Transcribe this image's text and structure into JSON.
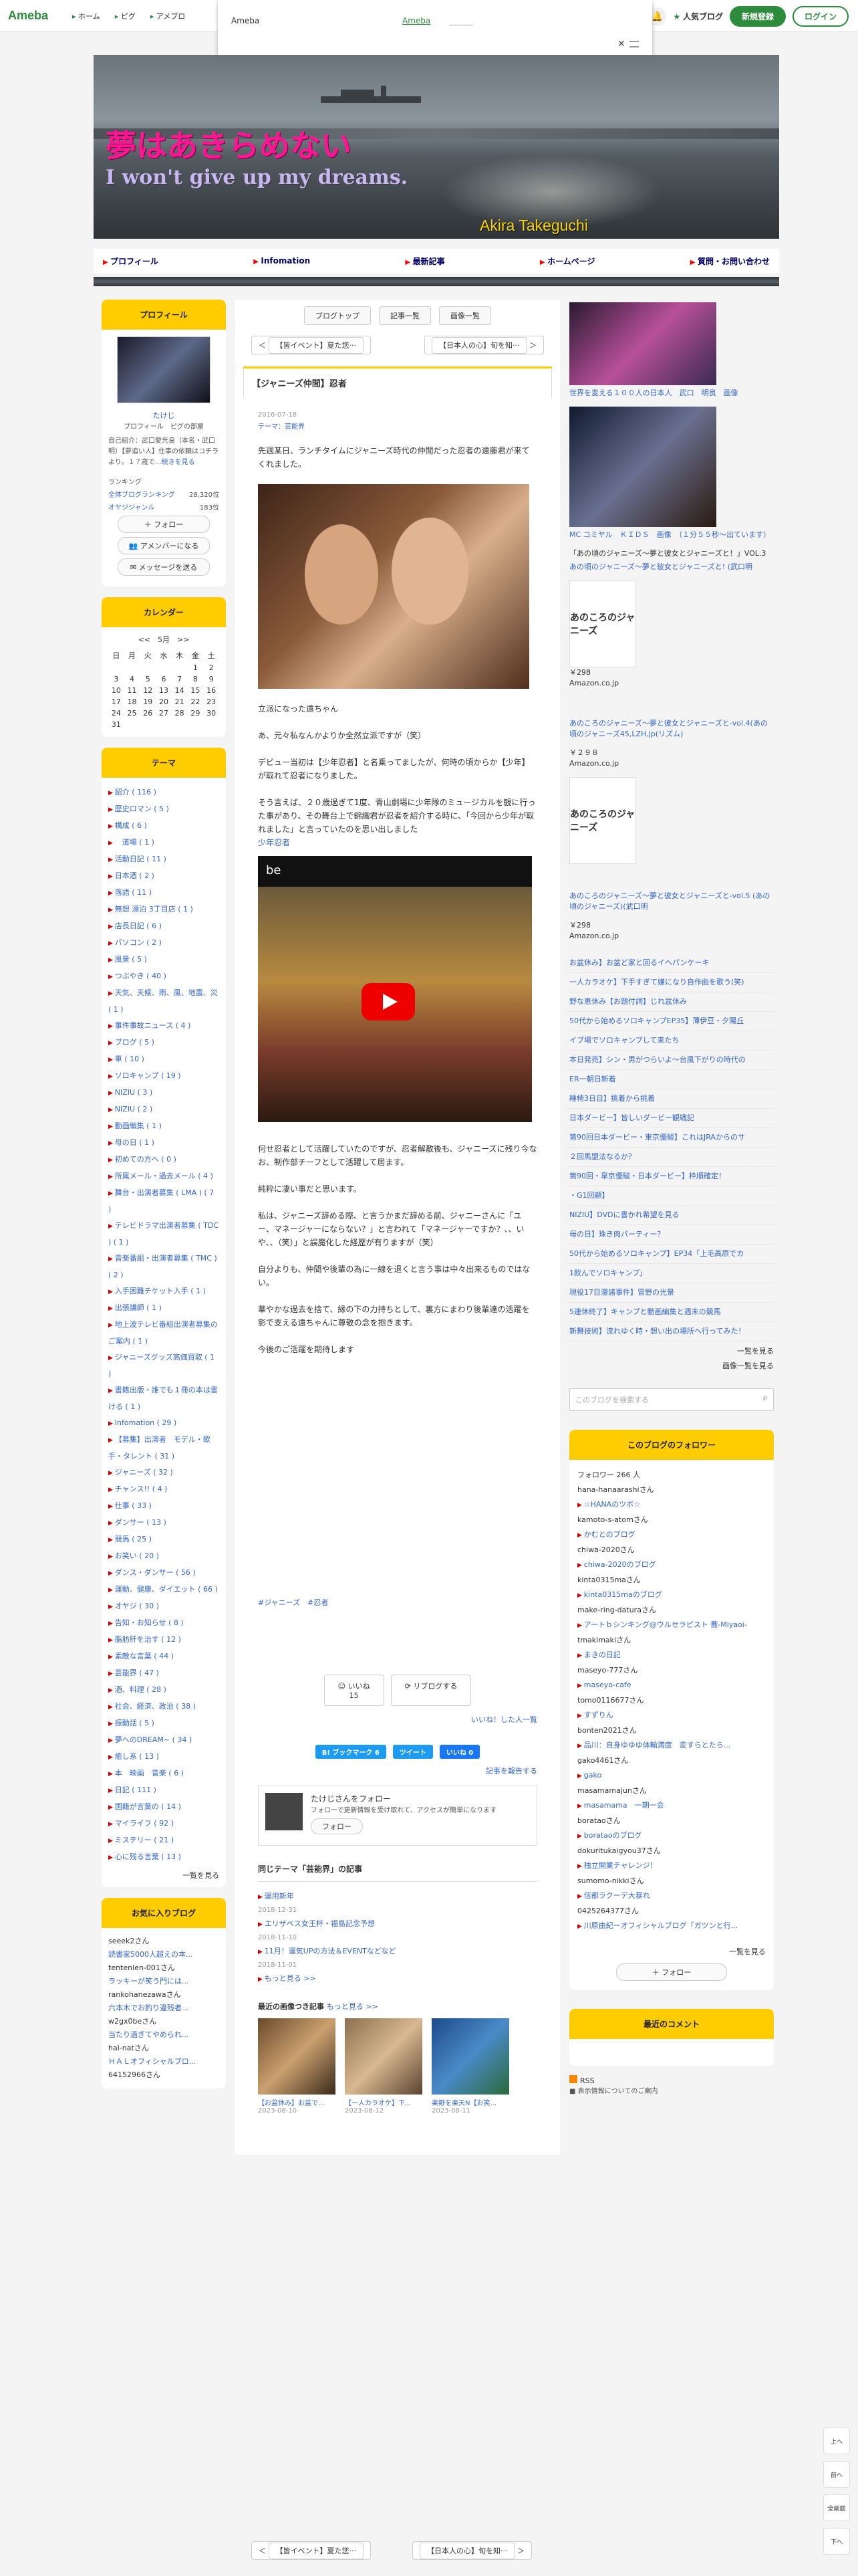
{
  "topbar": {
    "logo": "Ameba",
    "nav": [
      "ホーム",
      "ピグ",
      "アメブロ"
    ],
    "popup_title": "Ameba",
    "popup_link": "Ameba",
    "popular": "人気ブログ",
    "register": "新規登録",
    "login": "ログイン"
  },
  "header": {
    "title": "夢はあきらめない",
    "subtitle": "I won't give up my dreams.",
    "name": "Akira Takeguchi"
  },
  "gnav": [
    "プロフィール",
    "Infomation",
    "最新記事",
    "ホームページ",
    "質問・お問い合わせ"
  ],
  "profile": {
    "heading": "プロフィール",
    "name": "たけじ",
    "links": "プロフィール　ピグの部屋",
    "bio": "自己紹介：武口愛光良（本名・武口明）【夢追い人】仕事の依頼はコチラより。１７歳で",
    "bio_link": "…続きを見る",
    "ranking_label": "ランキング",
    "ranking_all": "全体ブログランキング",
    "ranking_all_val": "28,320位",
    "ranking_genre": "オヤジジャンル",
    "ranking_genre_val": "183位",
    "follow": "フォロー",
    "member": "アメンバーになる",
    "message": "メッセージを送る"
  },
  "calendar": {
    "heading": "カレンダー",
    "month": "5月",
    "days": [
      "日",
      "月",
      "火",
      "水",
      "木",
      "金",
      "土"
    ],
    "weeks": [
      [
        "",
        "",
        "",
        "",
        "",
        "1",
        "2"
      ],
      [
        "3",
        "4",
        "5",
        "6",
        "7",
        "8",
        "9"
      ],
      [
        "10",
        "11",
        "12",
        "13",
        "14",
        "15",
        "16"
      ],
      [
        "17",
        "18",
        "19",
        "20",
        "21",
        "22",
        "23"
      ],
      [
        "24",
        "25",
        "26",
        "27",
        "28",
        "29",
        "30"
      ],
      [
        "31",
        "",
        "",
        "",
        "",
        "",
        ""
      ]
    ]
  },
  "themes": {
    "heading": "テーマ",
    "items": [
      "紹介 ( 116 )",
      "歴史ロマン ( 5 )",
      "構成 ( 6 )",
      "　道場 ( 1 )",
      "活動日記 ( 11 )",
      "日本酒 ( 2 )",
      "落語 ( 11 )",
      "無想 漂泊 3丁目店 ( 1 )",
      "店長日記 ( 6 )",
      "パソコン ( 2 )",
      "風景 ( 5 )",
      "つぶやき ( 40 )",
      "天気、天候、雨、風、地震、災 ( 1 )",
      "事件事故ニュース ( 4 )",
      "ブログ ( 5 )",
      "車 ( 10 )",
      "ソロキャンプ ( 19 )",
      "NIZIU ( 3 )",
      "NIZIU ( 2 )",
      "動画編集 ( 1 )",
      "母の日 ( 1 )",
      "初めての方へ ( 0 )",
      "所属メール・過去メール ( 4 )",
      "舞台・出演者募集 ( LMA ) ( 7 )",
      "テレビドラマ出演者募集 ( TDC ) ( 1 )",
      "音楽番組・出演者募集 ( TMC ) ( 2 )",
      "入手困難チケット入手 ( 1 )",
      "出張講師 ( 1 )",
      "地上波テレビ番組出演者募集のご案内 ( 1 )",
      "ジャニーズグッズ高価買取 ( 1 )",
      "書籍出版・誰でも１冊の本は書ける ( 1 )",
      "Infomation ( 29 )",
      "【募集】出演者　モデル・歌手・タレント ( 31 )",
      "ジャニーズ ( 32 )",
      "チャンス!! ( 4 )",
      "仕事 ( 33 )",
      "ダンサー ( 13 )",
      "競馬 ( 25 )",
      "お笑い ( 20 )",
      "ダンス・ダンサー ( 56 )",
      "運動、健康、ダイエット ( 66 )",
      "オヤジ ( 30 )",
      "告知・お知らせ ( 8 )",
      "脂肪肝を治す ( 12 )",
      "素敵な言葉 ( 44 )",
      "芸能界 ( 47 )",
      "酒、料理 ( 28 )",
      "社会、経済、政治 ( 38 )",
      "振動話 ( 5 )",
      "夢へのDREAM~ ( 34 )",
      "癒し系 ( 13 )",
      "本　映画　音楽 ( 6 )",
      "日記 ( 111 )",
      "国籍が言葉の ( 14 )",
      "マイライフ ( 92 )",
      "ミステリー ( 21 )",
      "心に残る言葉 ( 13 )"
    ],
    "more": "一覧を見る"
  },
  "followed_blogs": {
    "heading": "お気に入りブログ",
    "items": [
      "seeek2さん",
      "読書家5000人超えの本...",
      "tentenlen-001さん",
      "ラッキーが笑う門には...",
      "rankohanezawaさん",
      "六本木でお釣り違残者...",
      "w2gx0beさん",
      "当たり過ぎてやめられ...",
      "hal-natさん",
      "ＨＡＬオフィシャルブロ...",
      "64152966さん"
    ]
  },
  "main": {
    "tabs": [
      "ブログトップ",
      "記事一覧",
      "画像一覧"
    ],
    "prev": "【皆イベント】夏た您···",
    "next": "【日本人の心】旬を知···",
    "title": "【ジャニーズ仲間】忍者",
    "date": "2016-07-18",
    "theme": "テーマ：芸能界",
    "p1": "先週某日、ランチタイムにジャニーズ時代の仲間だった忍者の遠藤君が来てくれました。",
    "p2": "立派になった遠ちゃん",
    "p3": "あ、元々私なんかよりか全然立派ですが（笑）",
    "p4": "デビュー当初は【少年忍者】と名乗ってましたが、何時の頃からか【少年】が取れて忍者になりました。",
    "p5": "そう言えば、２０歳過ぎて1度、青山劇場に少年隊のミュージカルを観に行った事があり、その舞台上で錦織君が忍者を紹介する時に、「今回から少年が取れました」と言っていたのを思い出しました",
    "p5_link": "少年忍者",
    "video_label": "be",
    "p6": "何せ忍者として活躍していたのですが、忍者解散後も、ジャニーズに残り今なお、制作部チーフとして活躍して居ます。",
    "p7": "純粋に凄い事だと思います。",
    "p8": "私は、ジャニーズ辞める際、と言うかまだ辞める前、ジャニーさんに「ユー、マネージャーにならない？」と言われて「マネージャーですか？、、いや、、（笑）」と誤魔化した経歴が有りますが（笑）",
    "p9": "自分よりも、仲間や後輩の為に一線を退くと言う事は中々出来るものではない。",
    "p10": "華やかな過去を捨て、縁の下の力持ちとして、裏方にまわり後輩達の活躍を影で支える遠ちゃんに尊敬の念を抱きます。",
    "p11": "今後のご活躍を期待します",
    "tags": "#ジャニーズ　#忍者",
    "like": "いいね",
    "like_count": "15",
    "reblog": "リブログする",
    "like_sub": "いいね！した人一覧",
    "share_b": "B! ブックマーク 6",
    "share_tw": "ツイート",
    "share_fb": "いいね 0",
    "report": "記事を報告する",
    "follow_title": "たけじさんをフォロー",
    "follow_sub": "フォローで更新情報を受け取れて、アクセスが簡単になります",
    "follow_btn": "フォロー",
    "same_theme": "同じテーマ「芸能界」の記事",
    "st": [
      {
        "t": "運用新年",
        "d": "2018-12-31"
      },
      {
        "t": "エリザベス女王杯・福島記念予想",
        "d": "2018-11-10"
      },
      {
        "t": "11月！運気UPの方法＆EVENTなどなど",
        "d": "2018-11-01"
      }
    ],
    "st_more": "もっと見る >>",
    "recent": "最近の画像つき記事",
    "recent_more": "もっと見る >>",
    "thumbs": [
      {
        "c": "【お盆休み】お盆で...",
        "d": "2023-08-10"
      },
      {
        "c": "【一人カラオケ】下...",
        "d": "2023-08-12"
      },
      {
        "c": "楽野を楽天N【お笑...",
        "d": "2023-08-11"
      }
    ]
  },
  "right": {
    "img1_cap": "世界を変える１００人の日本人　武口　明良　画像",
    "img2_cap": "MC コミヤル　ＫＩＤＳ　画像　（１分５５秒〜出ています）",
    "book_text1": "「あの頃のジャニーズ〜夢と彼女とジャニーズと！」VOL.3",
    "book_link1": "あの頃のジャニーズ〜夢と彼女とジャニーズと! (武口明",
    "book_title": "あのころのジャニーズ",
    "price1": "￥298",
    "amazon": "Amazon.co.jp",
    "book_link2": "あのころのジャニーズ〜夢と彼女とジャニーズと-vol.4(あの頃のジャニーズ45,LZH,jp(リズム)",
    "price2": "￥２９８",
    "book_link3": "あのころのジャニーズ〜夢と彼女とジャニーズと-vol.5 (あの頃のジャニーズ)(武口明",
    "price3": "￥298",
    "recent_list": [
      "お盆休み】お盆ど家と回るイヘパンケーキ",
      "一人カラオケ】下手すぎて嫌になり自作曲を歌う(笑)",
      "野な恵休み【お題付詞】じれ盆休み",
      "50代から始めるソロキャンプEP35】薄伊豆・夕陽丘",
      "イブ場でソロキャンプして来たち",
      "本日発売】シン・男がつらいよ〜台風下がりの時代の",
      "ER一朝日新着",
      "睡椅3日目】挑着から挑着",
      "日本ダービー】皆しいダービー観戦記",
      "第90回日本ダービー・東京優駿】これはJRAからのサ",
      "２回馬盟法なるか？",
      "第90回・皐京優駿・日本ダービー】枠順確定！",
      "・G1回顧】",
      "NIZIU】DVDに書かれ希望を見る",
      "母の日】珠き肉パーティー？",
      "50代から始めるソロキャンプ】EP34「上毛高原でカ",
      "1飲んでソロキャンプ」",
      "現役17目漫諸事件】冒野の光景",
      "5連休終了】キャンプと動画編集と週末の競馬",
      "新舞技術】流れゆく時・想い出の場所へ行ってみた！"
    ],
    "list_more": "一覧を見る",
    "image_list": "画像一覧を見る",
    "search_ph": "このブログを検索する",
    "followers_heading": "このブログのフォロワー",
    "followers_count": "フォロワー 266 人",
    "followers": [
      {
        "n": "hana-hanaarashiさん",
        "l": "☆HANAのツボ☆"
      },
      {
        "n": "kamoto-s-atomさん",
        "l": "かむとのブログ"
      },
      {
        "n": "chiwa-2020さん",
        "l": "chiwa-2020のブログ"
      },
      {
        "n": "kinta0315maさん",
        "l": "kinta0315maのブログ"
      },
      {
        "n": "make-ring-daturaさん",
        "l": "アートｂシンキング@ウルセラピスト 蕎-Miyaoi-"
      },
      {
        "n": "tmakimakiさん",
        "l": "まきの日記"
      },
      {
        "n": "maseyo-777さん",
        "l": "maseyo-cafe"
      },
      {
        "n": "tomo0116677さん",
        "l": "すずりん"
      },
      {
        "n": "bonten2021さん",
        "l": "品川：自身ゆゆゆ体輸満度　変すらとたら..."
      },
      {
        "n": "gako4461さん",
        "l": "gako"
      },
      {
        "n": "masamamajunさん",
        "l": "masamama　一期一会"
      },
      {
        "n": "borataoさん",
        "l": "borataoのブログ"
      },
      {
        "n": "dokuritukaigyou37さん",
        "l": "独立開業チャレンジ！"
      },
      {
        "n": "sumomo-nikkiさん",
        "l": "信都ラクーデ大暴れ"
      },
      {
        "n": "0425264377さん",
        "l": "川原由紀ーオフィシャルブログ「ガツンと行..."
      }
    ],
    "followers_more": "一覧を見る",
    "followers_btn": "フォロー",
    "comments_heading": "最近のコメント",
    "rss": "RSS",
    "rss_sub": "■ 表示情報についてのご案内"
  },
  "float": [
    "上へ",
    "前へ",
    "全画面",
    "下へ"
  ]
}
